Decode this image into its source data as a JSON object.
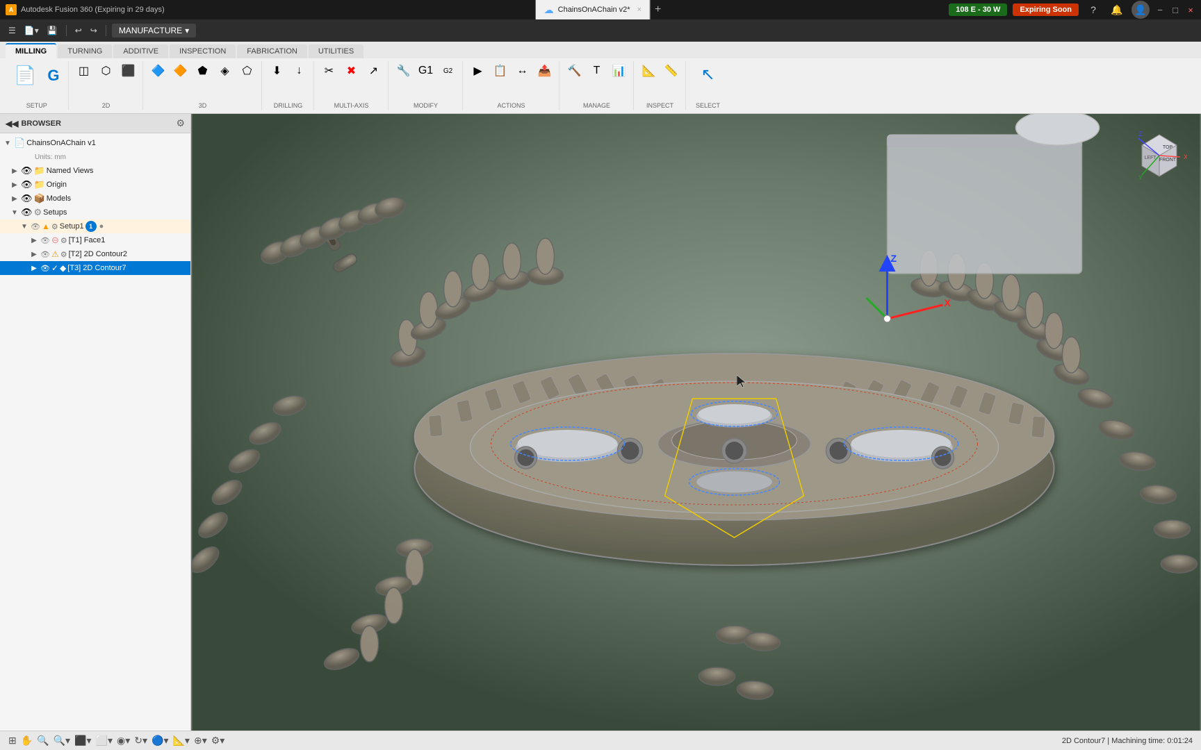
{
  "titlebar": {
    "app_title": "Autodesk Fusion 360 (Expiring in 29 days)",
    "file_name": "ChainsOnAChain v2*",
    "close_label": "×",
    "minimize_label": "−",
    "maximize_label": "□",
    "new_tab_label": "+"
  },
  "toolbar": {
    "manufacture_label": "MANUFACTURE",
    "manufacture_arrow": "▾",
    "tabs": [
      {
        "id": "milling",
        "label": "MILLING",
        "active": true
      },
      {
        "id": "turning",
        "label": "TURNING",
        "active": false
      },
      {
        "id": "additive",
        "label": "ADDITIVE",
        "active": false
      },
      {
        "id": "inspection",
        "label": "INSPECTION",
        "active": false
      },
      {
        "id": "fabrication",
        "label": "FABRICATION",
        "active": false
      },
      {
        "id": "utilities",
        "label": "UTILITIES",
        "active": false
      }
    ],
    "groups": {
      "setup": {
        "label": "SETUP",
        "buttons": [
          "Setup ▾"
        ]
      },
      "2d": {
        "label": "2D",
        "buttons": [
          "2D ▾"
        ]
      },
      "3d": {
        "label": "3D",
        "buttons": [
          "3D ▾"
        ]
      },
      "drilling": {
        "label": "DRILLING",
        "buttons": [
          "DRILLING ▾"
        ]
      },
      "multi_axis": {
        "label": "MULTI-AXIS",
        "buttons": [
          "MULTI-AXIS ▾"
        ]
      },
      "modify": {
        "label": "MODIFY",
        "buttons": [
          "MODIFY ▾"
        ]
      },
      "actions": {
        "label": "ACTIONS",
        "buttons": [
          "ACTIONS ▾"
        ]
      },
      "manage": {
        "label": "MANAGE",
        "buttons": [
          "MANAGE ▾"
        ]
      },
      "inspect": {
        "label": "INSPECT",
        "buttons": [
          "INSPECT ▾"
        ]
      },
      "select": {
        "label": "SELECT",
        "buttons": [
          "SELECT ▾"
        ]
      }
    }
  },
  "header_buttons": {
    "cloud_label": "108 E - 30 W",
    "expiring_label": "Expiring Soon",
    "help_label": "?"
  },
  "browser": {
    "title": "BROWSER",
    "items": [
      {
        "id": "root",
        "label": "ChainsOnAChain v1",
        "indent": 0,
        "expanded": true,
        "icon": "📄"
      },
      {
        "id": "units",
        "label": "Units: mm",
        "indent": 1,
        "type": "info"
      },
      {
        "id": "named_views",
        "label": "Named Views",
        "indent": 1,
        "icon": "📁",
        "expanded": false
      },
      {
        "id": "origin",
        "label": "Origin",
        "indent": 1,
        "icon": "📁"
      },
      {
        "id": "models",
        "label": "Models",
        "indent": 1,
        "icon": "📦"
      },
      {
        "id": "setups",
        "label": "Setups",
        "indent": 1,
        "icon": "⚙",
        "expanded": true
      },
      {
        "id": "setup1",
        "label": "Setup1",
        "indent": 2,
        "icon": "⚙",
        "type": "setup",
        "badge": "1"
      },
      {
        "id": "t1",
        "label": "[T1] Face1",
        "indent": 3,
        "icon": "⭕",
        "warning": false
      },
      {
        "id": "t2",
        "label": "[T2] 2D Contour2",
        "indent": 3,
        "icon": "⭕",
        "warning": true
      },
      {
        "id": "t3",
        "label": "[T3] 2D Contour7",
        "indent": 3,
        "icon": "◆",
        "selected": true
      }
    ]
  },
  "status_bar": {
    "status_text": "2D Contour7 | Machining time: 0:01:24",
    "tools": [
      "pan",
      "zoom",
      "fit",
      "orbit",
      "display",
      "grid",
      "snap",
      "settings"
    ]
  },
  "viewport": {
    "model_name": "ChainsOnAChain",
    "view_cube": {
      "top": "TOP",
      "left": "LEFT",
      "front": "FRONT"
    }
  }
}
